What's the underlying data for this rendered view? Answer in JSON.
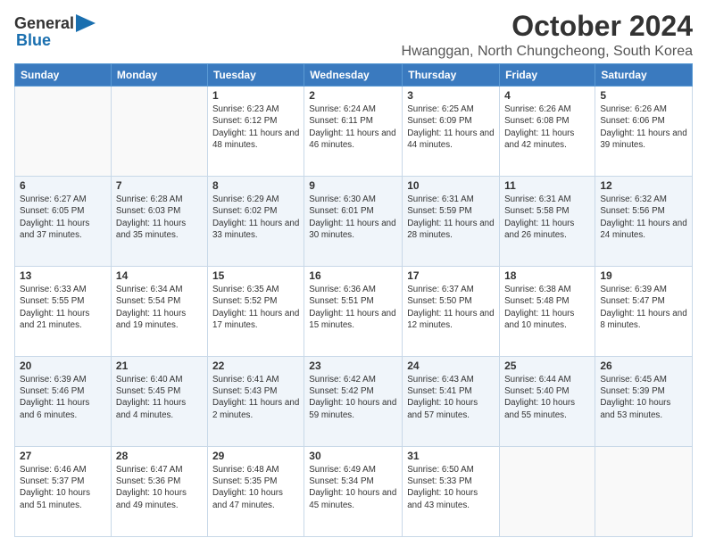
{
  "logo": {
    "text1": "General",
    "text2": "Blue"
  },
  "title": "October 2024",
  "subtitle": "Hwanggan, North Chungcheong, South Korea",
  "days_header": [
    "Sunday",
    "Monday",
    "Tuesday",
    "Wednesday",
    "Thursday",
    "Friday",
    "Saturday"
  ],
  "weeks": [
    [
      {
        "day": "",
        "info": ""
      },
      {
        "day": "",
        "info": ""
      },
      {
        "day": "1",
        "info": "Sunrise: 6:23 AM\nSunset: 6:12 PM\nDaylight: 11 hours and 48 minutes."
      },
      {
        "day": "2",
        "info": "Sunrise: 6:24 AM\nSunset: 6:11 PM\nDaylight: 11 hours and 46 minutes."
      },
      {
        "day": "3",
        "info": "Sunrise: 6:25 AM\nSunset: 6:09 PM\nDaylight: 11 hours and 44 minutes."
      },
      {
        "day": "4",
        "info": "Sunrise: 6:26 AM\nSunset: 6:08 PM\nDaylight: 11 hours and 42 minutes."
      },
      {
        "day": "5",
        "info": "Sunrise: 6:26 AM\nSunset: 6:06 PM\nDaylight: 11 hours and 39 minutes."
      }
    ],
    [
      {
        "day": "6",
        "info": "Sunrise: 6:27 AM\nSunset: 6:05 PM\nDaylight: 11 hours and 37 minutes."
      },
      {
        "day": "7",
        "info": "Sunrise: 6:28 AM\nSunset: 6:03 PM\nDaylight: 11 hours and 35 minutes."
      },
      {
        "day": "8",
        "info": "Sunrise: 6:29 AM\nSunset: 6:02 PM\nDaylight: 11 hours and 33 minutes."
      },
      {
        "day": "9",
        "info": "Sunrise: 6:30 AM\nSunset: 6:01 PM\nDaylight: 11 hours and 30 minutes."
      },
      {
        "day": "10",
        "info": "Sunrise: 6:31 AM\nSunset: 5:59 PM\nDaylight: 11 hours and 28 minutes."
      },
      {
        "day": "11",
        "info": "Sunrise: 6:31 AM\nSunset: 5:58 PM\nDaylight: 11 hours and 26 minutes."
      },
      {
        "day": "12",
        "info": "Sunrise: 6:32 AM\nSunset: 5:56 PM\nDaylight: 11 hours and 24 minutes."
      }
    ],
    [
      {
        "day": "13",
        "info": "Sunrise: 6:33 AM\nSunset: 5:55 PM\nDaylight: 11 hours and 21 minutes."
      },
      {
        "day": "14",
        "info": "Sunrise: 6:34 AM\nSunset: 5:54 PM\nDaylight: 11 hours and 19 minutes."
      },
      {
        "day": "15",
        "info": "Sunrise: 6:35 AM\nSunset: 5:52 PM\nDaylight: 11 hours and 17 minutes."
      },
      {
        "day": "16",
        "info": "Sunrise: 6:36 AM\nSunset: 5:51 PM\nDaylight: 11 hours and 15 minutes."
      },
      {
        "day": "17",
        "info": "Sunrise: 6:37 AM\nSunset: 5:50 PM\nDaylight: 11 hours and 12 minutes."
      },
      {
        "day": "18",
        "info": "Sunrise: 6:38 AM\nSunset: 5:48 PM\nDaylight: 11 hours and 10 minutes."
      },
      {
        "day": "19",
        "info": "Sunrise: 6:39 AM\nSunset: 5:47 PM\nDaylight: 11 hours and 8 minutes."
      }
    ],
    [
      {
        "day": "20",
        "info": "Sunrise: 6:39 AM\nSunset: 5:46 PM\nDaylight: 11 hours and 6 minutes."
      },
      {
        "day": "21",
        "info": "Sunrise: 6:40 AM\nSunset: 5:45 PM\nDaylight: 11 hours and 4 minutes."
      },
      {
        "day": "22",
        "info": "Sunrise: 6:41 AM\nSunset: 5:43 PM\nDaylight: 11 hours and 2 minutes."
      },
      {
        "day": "23",
        "info": "Sunrise: 6:42 AM\nSunset: 5:42 PM\nDaylight: 10 hours and 59 minutes."
      },
      {
        "day": "24",
        "info": "Sunrise: 6:43 AM\nSunset: 5:41 PM\nDaylight: 10 hours and 57 minutes."
      },
      {
        "day": "25",
        "info": "Sunrise: 6:44 AM\nSunset: 5:40 PM\nDaylight: 10 hours and 55 minutes."
      },
      {
        "day": "26",
        "info": "Sunrise: 6:45 AM\nSunset: 5:39 PM\nDaylight: 10 hours and 53 minutes."
      }
    ],
    [
      {
        "day": "27",
        "info": "Sunrise: 6:46 AM\nSunset: 5:37 PM\nDaylight: 10 hours and 51 minutes."
      },
      {
        "day": "28",
        "info": "Sunrise: 6:47 AM\nSunset: 5:36 PM\nDaylight: 10 hours and 49 minutes."
      },
      {
        "day": "29",
        "info": "Sunrise: 6:48 AM\nSunset: 5:35 PM\nDaylight: 10 hours and 47 minutes."
      },
      {
        "day": "30",
        "info": "Sunrise: 6:49 AM\nSunset: 5:34 PM\nDaylight: 10 hours and 45 minutes."
      },
      {
        "day": "31",
        "info": "Sunrise: 6:50 AM\nSunset: 5:33 PM\nDaylight: 10 hours and 43 minutes."
      },
      {
        "day": "",
        "info": ""
      },
      {
        "day": "",
        "info": ""
      }
    ]
  ]
}
